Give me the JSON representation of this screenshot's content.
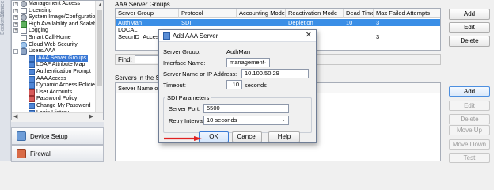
{
  "left_strip": {
    "tabs": [
      "Device",
      "Bookmarks"
    ]
  },
  "tree": {
    "items": [
      {
        "label": "Management Access",
        "indent": 1,
        "icon": "gear",
        "expander": "+"
      },
      {
        "label": "Licensing",
        "indent": 1,
        "icon": "doc",
        "expander": "+"
      },
      {
        "label": "System Image/Configuration",
        "indent": 1,
        "icon": "gear",
        "expander": "+"
      },
      {
        "label": "High Availability and Scalabilit",
        "indent": 1,
        "icon": "green",
        "expander": "+"
      },
      {
        "label": "Logging",
        "indent": 1,
        "icon": "doc",
        "expander": "+"
      },
      {
        "label": "Smart Call-Home",
        "indent": 1,
        "icon": "doc",
        "expander": ""
      },
      {
        "label": "Cloud Web Security",
        "indent": 1,
        "icon": "cloud",
        "expander": ""
      },
      {
        "label": "Users/AAA",
        "indent": 1,
        "icon": "users",
        "expander": "-"
      },
      {
        "label": "AAA Server Groups",
        "indent": 2,
        "icon": "blue",
        "expander": "",
        "selected": true
      },
      {
        "label": "LDAP Attribute Map",
        "indent": 2,
        "icon": "blue",
        "expander": ""
      },
      {
        "label": "Authentication Prompt",
        "indent": 2,
        "icon": "blue",
        "expander": ""
      },
      {
        "label": "AAA Access",
        "indent": 2,
        "icon": "blue",
        "expander": ""
      },
      {
        "label": "Dynamic Access Policies",
        "indent": 2,
        "icon": "blue",
        "expander": ""
      },
      {
        "label": "User Accounts",
        "indent": 2,
        "icon": "red",
        "expander": ""
      },
      {
        "label": "Password Policy",
        "indent": 2,
        "icon": "red",
        "expander": ""
      },
      {
        "label": "Change My Password",
        "indent": 2,
        "icon": "blue",
        "expander": ""
      },
      {
        "label": "Login History",
        "indent": 2,
        "icon": "blue",
        "expander": ""
      }
    ]
  },
  "nav": {
    "device_setup": "Device Setup",
    "firewall": "Firewall"
  },
  "server_groups": {
    "title": "AAA Server Groups",
    "columns": [
      "Server Group",
      "Protocol",
      "Accounting Mode",
      "Reactivation Mode",
      "Dead Time",
      "Max Failed Attempts"
    ],
    "rows": [
      {
        "cells": [
          "AuthMan",
          "SDI",
          "",
          "Depletion",
          "10",
          "3"
        ],
        "selected": true
      },
      {
        "cells": [
          "LOCAL",
          "",
          "",
          "",
          "",
          ""
        ],
        "selected": false
      },
      {
        "cells": [
          "SecurID_Access",
          "",
          "",
          "",
          "",
          "3"
        ],
        "selected": false
      }
    ],
    "buttons": [
      "Add",
      "Edit",
      "Delete"
    ]
  },
  "find": {
    "label": "Find:"
  },
  "servers_in_group": {
    "title": "Servers in the Selected Group",
    "columns": [
      "Server Name or IP Address"
    ],
    "buttons": [
      {
        "label": "Add",
        "enabled": true,
        "focused": true
      },
      {
        "label": "Edit",
        "enabled": false
      },
      {
        "label": "Delete",
        "enabled": false
      },
      {
        "label": "Move Up",
        "enabled": false
      },
      {
        "label": "Move Down",
        "enabled": false
      },
      {
        "label": "Test",
        "enabled": false
      }
    ]
  },
  "dialog": {
    "title": "Add AAA Server",
    "server_group_label": "Server Group:",
    "server_group_value": "AuthMan",
    "interface_label": "Interface Name:",
    "interface_value": "management",
    "server_label": "Server Name or IP Address:",
    "server_value": "10.100.50.29",
    "timeout_label": "Timeout:",
    "timeout_value": "10",
    "timeout_unit": "seconds",
    "sdi_group_label": "SDI Parameters",
    "server_port_label": "Server Port:",
    "server_port_value": "5500",
    "retry_label": "Retry Interval:",
    "retry_value": "10 seconds",
    "ok_label": "OK",
    "cancel_label": "Cancel",
    "help_label": "Help"
  },
  "colors": {
    "selection": "#3a8ee6",
    "annotation_arrow": "#e02020"
  }
}
